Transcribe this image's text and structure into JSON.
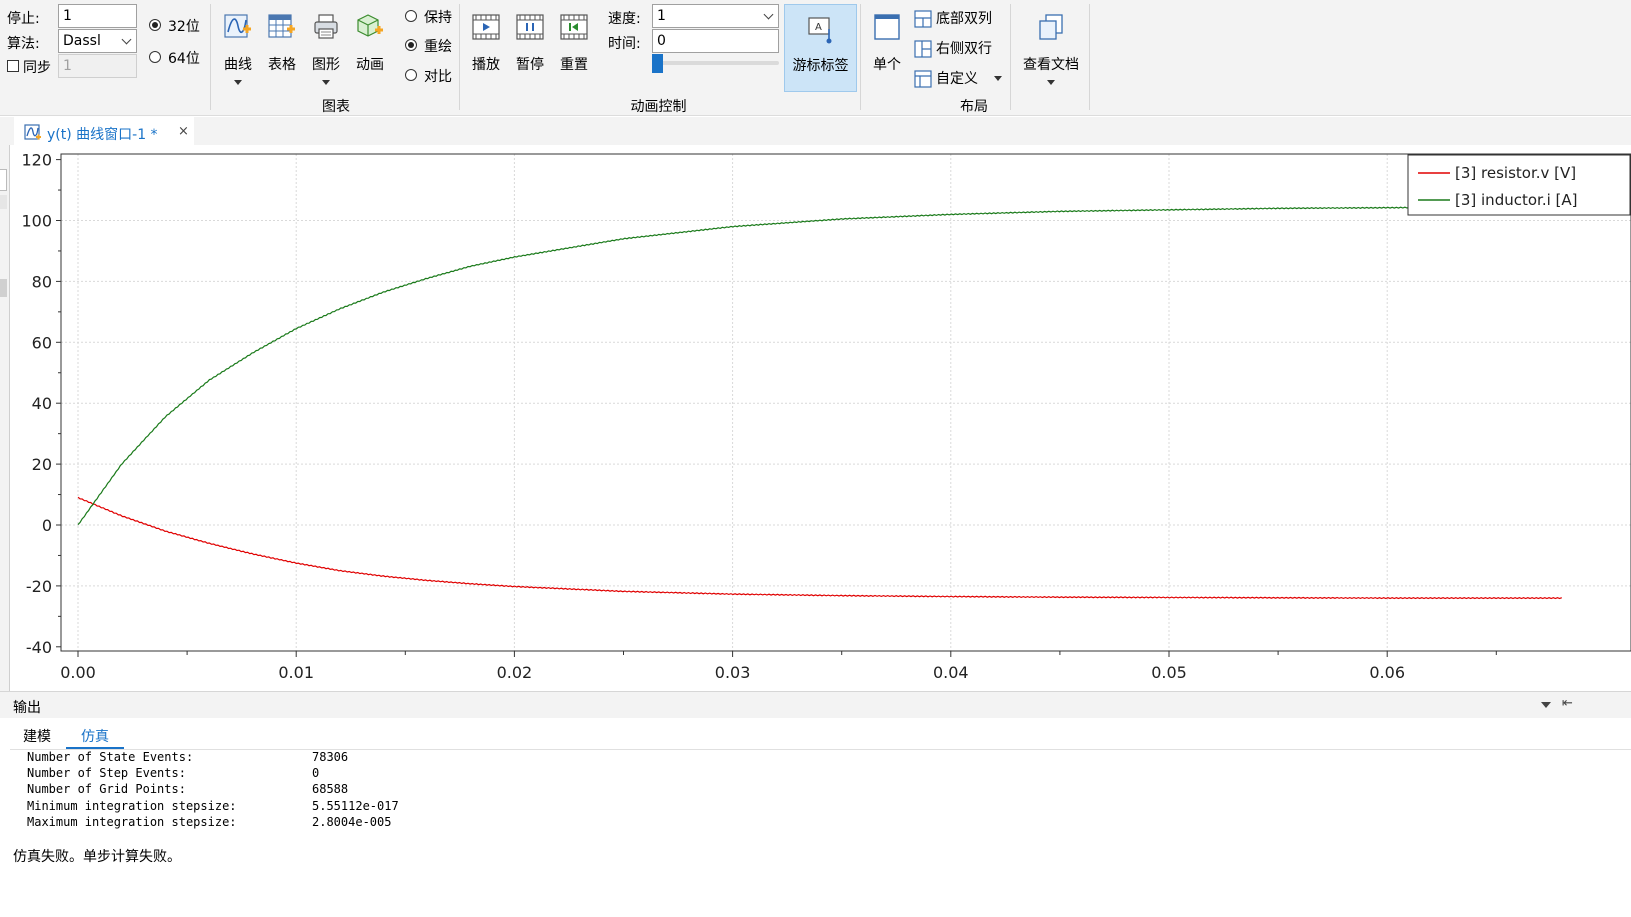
{
  "ribbon": {
    "stop_label": "停止:",
    "stop_value": "1",
    "algo_label": "算法:",
    "algo_value": "Dassl",
    "sync_label": "同步",
    "sync_value": "1",
    "bits_32": "32位",
    "bits_64": "64位",
    "chart_group": {
      "label": "图表",
      "buttons": [
        "曲线",
        "表格",
        "图形",
        "动画"
      ]
    },
    "mode_options": [
      "保持",
      "重绘",
      "对比"
    ],
    "animation_group": {
      "label": "动画控制",
      "buttons": [
        "播放",
        "暂停",
        "重置"
      ],
      "speed_label": "速度:",
      "speed_value": "1",
      "time_label": "时间:",
      "time_value": "0"
    },
    "cursor_label_button": "游标标签",
    "layout_group": {
      "label": "布局",
      "single": "单个",
      "bottom_two_col": "底部双列",
      "right_two_row": "右侧双行",
      "custom": "自定义"
    },
    "view_doc": "查看文档"
  },
  "tab": {
    "title": "y(t) 曲线窗口-1 *",
    "close": "×"
  },
  "chart_data": {
    "type": "line",
    "xlim": [
      0.0,
      0.068
    ],
    "ylim": [
      -40,
      120
    ],
    "x_ticks": [
      "0.00",
      "0.01",
      "0.02",
      "0.03",
      "0.04",
      "0.05",
      "0.06"
    ],
    "y_ticks": [
      "120",
      "100",
      "80",
      "60",
      "40",
      "20",
      "0",
      "-20",
      "-40"
    ],
    "grid": true,
    "legend_position": "top-right",
    "series": [
      {
        "name": "[3] resistor.v [V]",
        "color": "#e00000",
        "x": [
          0.0,
          0.002,
          0.004,
          0.006,
          0.008,
          0.01,
          0.012,
          0.014,
          0.016,
          0.018,
          0.02,
          0.025,
          0.03,
          0.035,
          0.04,
          0.045,
          0.05,
          0.055,
          0.06,
          0.068
        ],
        "y": [
          9.0,
          3.0,
          -2.0,
          -6.0,
          -9.5,
          -12.5,
          -15.0,
          -16.8,
          -18.2,
          -19.3,
          -20.2,
          -21.8,
          -22.7,
          -23.2,
          -23.5,
          -23.7,
          -23.8,
          -23.9,
          -24.0,
          -24.0
        ]
      },
      {
        "name": "[3] inductor.i [A]",
        "color": "#1a7a1a",
        "x": [
          0.0,
          0.002,
          0.004,
          0.006,
          0.008,
          0.01,
          0.012,
          0.014,
          0.016,
          0.018,
          0.02,
          0.025,
          0.03,
          0.035,
          0.04,
          0.045,
          0.05,
          0.055,
          0.06,
          0.068
        ],
        "y": [
          0.0,
          20.0,
          35.5,
          47.5,
          56.5,
          64.5,
          71.0,
          76.5,
          81.0,
          85.0,
          88.0,
          94.0,
          98.0,
          100.5,
          102.0,
          103.0,
          103.5,
          104.0,
          104.2,
          104.5
        ]
      }
    ]
  },
  "output": {
    "title": "输出",
    "tabs": [
      "建模",
      "仿真"
    ],
    "active_tab": "仿真",
    "rows": [
      {
        "label": "Number of State Events:",
        "value": "78306"
      },
      {
        "label": "Number of Step Events:",
        "value": "0"
      },
      {
        "label": "Number of Grid Points:",
        "value": "68588"
      },
      {
        "label": "Minimum integration stepsize:",
        "value": "5.55112e-017"
      },
      {
        "label": "Maximum integration stepsize:",
        "value": "2.8004e-005"
      }
    ],
    "message": "仿真失败。单步计算失败。"
  },
  "colors": {
    "accent": "#1a73c8",
    "ribbon_bg": "#f3f3f3",
    "active_button": "#cce4f7"
  }
}
